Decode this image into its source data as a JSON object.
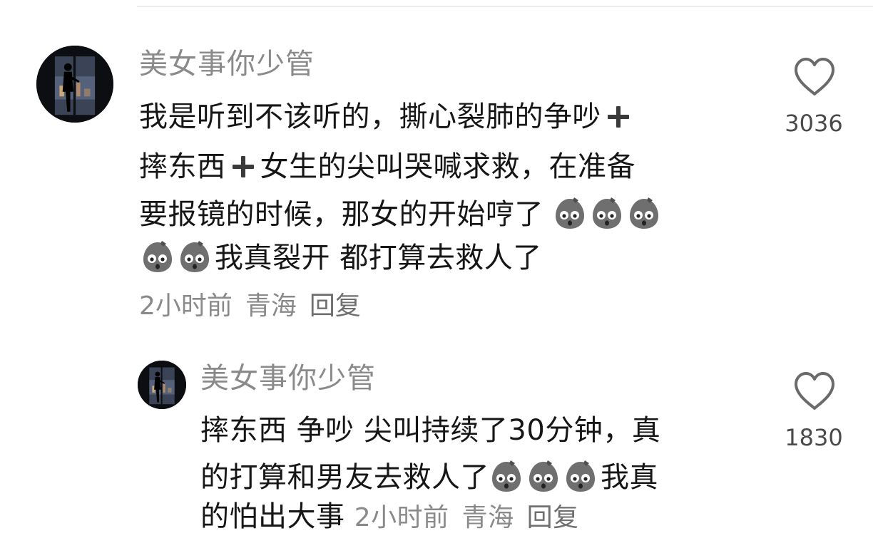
{
  "comment": {
    "username": "美女事你少管",
    "lines": [
      [
        "我是听到不该听的，撕心裂肺的争吵"
      ],
      [
        "摔东西",
        "女生的尖叫哭喊求救，在准备"
      ],
      [
        "要报镜的时候，那女的开始哼了"
      ],
      [
        "我真裂开 都打算去救人了"
      ]
    ],
    "time": "2小时前",
    "location": "青海",
    "reply_label": "回复",
    "likes": "3036"
  },
  "reply": {
    "username": "美女事你少管",
    "lines": [
      [
        "摔东西 争吵 尖叫持续了30分钟，真"
      ],
      [
        "的打算和男友去救人了",
        "我真"
      ],
      [
        "的怕出大事"
      ]
    ],
    "time": "2小时前",
    "location": "青海",
    "reply_label": "回复",
    "likes": "1830"
  },
  "icons": {
    "like": "heart-outline-icon",
    "emoji": "shocked-potato-emoji",
    "plus": "plus-icon"
  },
  "colors": {
    "text": "#161616",
    "muted": "#8a8a8a",
    "count": "#4a4a4a"
  }
}
